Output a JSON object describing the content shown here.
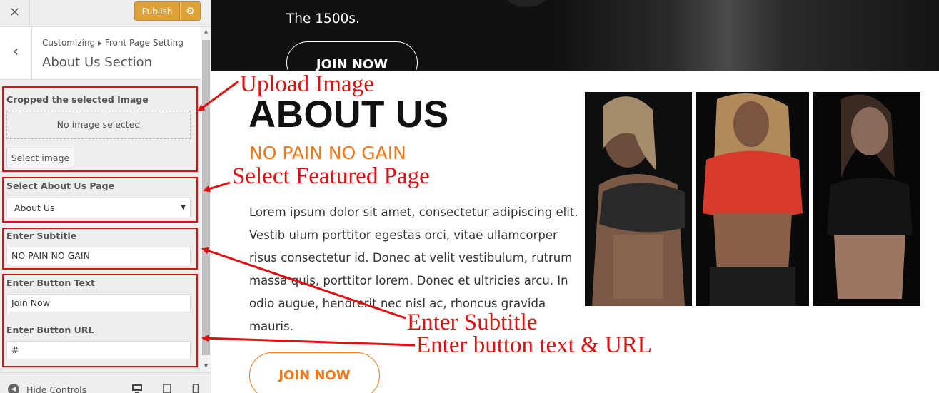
{
  "sidebar": {
    "close_icon": "×",
    "publish_label": "Publish",
    "gear_icon": "⚙",
    "back_icon": "‹",
    "breadcrumb": "Customizing ▸ Front Page Setting",
    "section_title": "About Us Section",
    "image_field": {
      "label": "Cropped the selected Image",
      "placeholder": "No image selected",
      "button": "Select image"
    },
    "page_field": {
      "label": "Select About Us Page",
      "value": "About Us"
    },
    "subtitle_field": {
      "label": "Enter Subtitle",
      "value": "NO PAIN NO GAIN"
    },
    "button_text_field": {
      "label": "Enter Button Text",
      "value": "Join Now"
    },
    "button_url_field": {
      "label": "Enter Button URL",
      "value": "#"
    },
    "hide_controls": "Hide Controls"
  },
  "preview": {
    "hero": {
      "text": "The 1500s.",
      "button": "JOIN NOW"
    },
    "about": {
      "title": "ABOUT US",
      "subtitle": "NO PAIN NO GAIN",
      "body": "Lorem ipsum dolor sit amet, consectetur adipiscing elit. Vestib ulum porttitor egestas orci, vitae ullamcorper risus consectetur id. Donec at velit vestibulum, rutrum massa quis, porttitor lorem. Donec et ultricies arcu. In odio augue, hendrerit nec nisl ac, rhoncus gravida mauris.",
      "button": "JOIN NOW"
    },
    "photos": [
      "woman-sports-bra-photo",
      "woman-red-top-photo",
      "woman-black-top-photo"
    ]
  },
  "annotations": {
    "upload_image": "Upload Image",
    "select_featured_page": "Select Featured Page",
    "enter_subtitle": "Enter Subtitle",
    "enter_button": "Enter button text & URL"
  },
  "colors": {
    "publish": "#dea239",
    "accent_orange": "#f07818",
    "annotation_red": "#e01010"
  }
}
